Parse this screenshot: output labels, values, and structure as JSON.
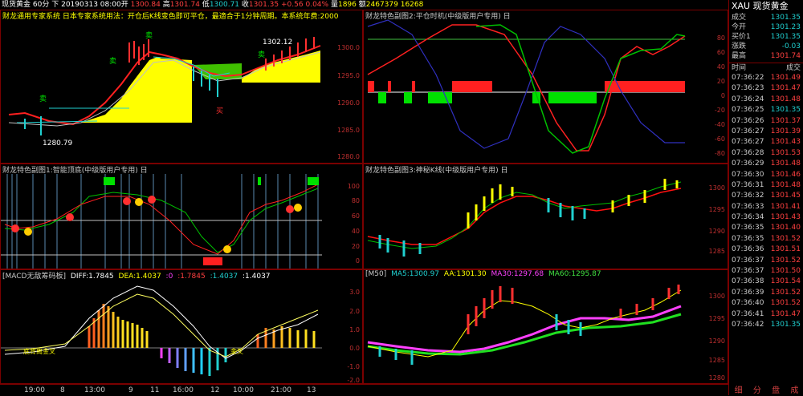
{
  "top_bar": {
    "symbol_name": "现货黄金",
    "period": "60分",
    "direction": "下",
    "datetime": "20190313 08:00开",
    "open": "1300.84",
    "high_label": "高",
    "high": "1301.74",
    "low_label": "低",
    "low": "1300.71",
    "close_label": "收",
    "close": "1301.35",
    "change": "+0.56",
    "change_pct": "0.04%",
    "volume_label": "量",
    "volume": "1896",
    "amount_label": "额",
    "amount": "2467379",
    "extra": "16268"
  },
  "panes": {
    "main": {
      "title": "财龙通用专家系统 日本专家系统用法：开仓后K线变色即可平仓，最適合于1分钟周期。本系统年费:2000",
      "label_high": "1302.12",
      "label_low": "1280.79",
      "sell_label": "卖",
      "buy_label": "买",
      "axis": [
        "1300.0",
        "1295.0",
        "1290.0",
        "1285.0",
        "1280.0"
      ]
    },
    "sub2": {
      "title": "财龙特色副图2:平仓时机(中级版用户专用) 日",
      "axis": [
        "80",
        "60",
        "40",
        "20",
        "0",
        "-20",
        "-40",
        "-60",
        "-80"
      ]
    },
    "sub1": {
      "title": "财龙特色副图1:智能顶底(中级版用户专用) 日",
      "axis": [
        "100",
        "80",
        "60",
        "40",
        "20",
        "0"
      ]
    },
    "sub3": {
      "title": "财龙特色副图3:神秘K线(中级版用户专用) 日",
      "axis": [
        "1300",
        "1295",
        "1290",
        "1285"
      ]
    },
    "macd": {
      "title": "[MACD无敌筹码板]",
      "diff_label": "DIFF:1.7845",
      "dea_label": "DEA:1.4037",
      "zero_label": ":0",
      "v1": ":1.7845",
      "v2": ":1.4037",
      "v3": ":1.4037",
      "cross1": "底背离金叉",
      "cross2": "金叉",
      "axis": [
        "3.0",
        "2.0",
        "1.0",
        "0.0",
        "-1.0",
        "-2.0"
      ]
    },
    "ma": {
      "title": "[M50]",
      "ma5": "MA5:1300.97",
      "aa": "AA:1301.30",
      "ma30": "MA30:1297.68",
      "ma60": "MA60:1295.87",
      "axis": [
        "1300",
        "1295",
        "1290",
        "1285",
        "1280"
      ]
    }
  },
  "time_axis": [
    "19:00",
    "8",
    "13:00",
    "9",
    "11",
    "16:00",
    "12",
    "10:00",
    "21:00",
    "13"
  ],
  "side_panel": {
    "code": "XAU",
    "name": "现货黄金",
    "quotes": [
      {
        "label": "成交",
        "value": "1301.35"
      },
      {
        "label": "今开",
        "value": "1301.23"
      },
      {
        "label": "买价1",
        "value": "1301.35"
      },
      {
        "label": "涨跌",
        "value": "-0.03"
      },
      {
        "label": "最高",
        "value": "1301.74"
      }
    ],
    "tick_header": {
      "time": "时间",
      "price": "成交"
    },
    "ticks": [
      {
        "time": "07:36:22",
        "price": "1301.49"
      },
      {
        "time": "07:36:23",
        "price": "1301.47"
      },
      {
        "time": "07:36:24",
        "price": "1301.48"
      },
      {
        "time": "07:36:25",
        "price": "1301.35"
      },
      {
        "time": "07:36:26",
        "price": "1301.37"
      },
      {
        "time": "07:36:27",
        "price": "1301.39"
      },
      {
        "time": "07:36:27",
        "price": "1301.43"
      },
      {
        "time": "07:36:28",
        "price": "1301.53"
      },
      {
        "time": "07:36:29",
        "price": "1301.48"
      },
      {
        "time": "07:36:30",
        "price": "1301.46"
      },
      {
        "time": "07:36:31",
        "price": "1301.48"
      },
      {
        "time": "07:36:32",
        "price": "1301.45"
      },
      {
        "time": "07:36:33",
        "price": "1301.41"
      },
      {
        "time": "07:36:34",
        "price": "1301.43"
      },
      {
        "time": "07:36:35",
        "price": "1301.40"
      },
      {
        "time": "07:36:35",
        "price": "1301.52"
      },
      {
        "time": "07:36:36",
        "price": "1301.51"
      },
      {
        "time": "07:36:37",
        "price": "1301.52"
      },
      {
        "time": "07:36:37",
        "price": "1301.50"
      },
      {
        "time": "07:36:38",
        "price": "1301.54"
      },
      {
        "time": "07:36:39",
        "price": "1301.52"
      },
      {
        "time": "07:36:40",
        "price": "1301.52"
      },
      {
        "time": "07:36:41",
        "price": "1301.47"
      },
      {
        "time": "07:36:42",
        "price": "1301.35"
      }
    ],
    "tabs": [
      "细",
      "分",
      "盘",
      "成"
    ]
  },
  "colors": {
    "up": "#ff3030",
    "down": "#20d0d0",
    "yellow": "#ffff00",
    "green": "#00cc00",
    "frame": "#7a0000"
  }
}
